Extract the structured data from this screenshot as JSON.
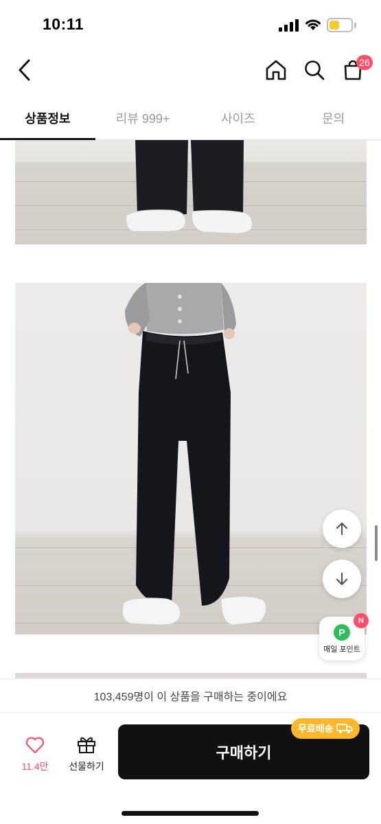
{
  "status_bar": {
    "time": "10:11"
  },
  "header": {
    "cart_count": "26"
  },
  "tabs": [
    {
      "label": "상품정보",
      "active": true
    },
    {
      "label": "리뷰 999+",
      "active": false
    },
    {
      "label": "사이즈",
      "active": false
    },
    {
      "label": "문의",
      "active": false
    }
  ],
  "floating": {
    "points_icon": "P",
    "points_label": "매일 포인트",
    "new_badge": "N"
  },
  "buyers_text": "103,459명이 이 상품을 구매하는 중이에요",
  "bottom_bar": {
    "like_count": "11.4만",
    "gift_label": "선물하기",
    "buy_label": "구매하기",
    "shipping_badge": "무료배송"
  },
  "colors": {
    "accent": "#ff4d6a",
    "points_green": "#2fbd59",
    "shipping_yellow": "#fcb82a",
    "buy_button": "#111111"
  },
  "icons": [
    "back-icon",
    "home-icon",
    "search-icon",
    "cart-icon",
    "arrow-up-icon",
    "arrow-down-icon",
    "heart-icon",
    "gift-icon",
    "truck-icon"
  ]
}
